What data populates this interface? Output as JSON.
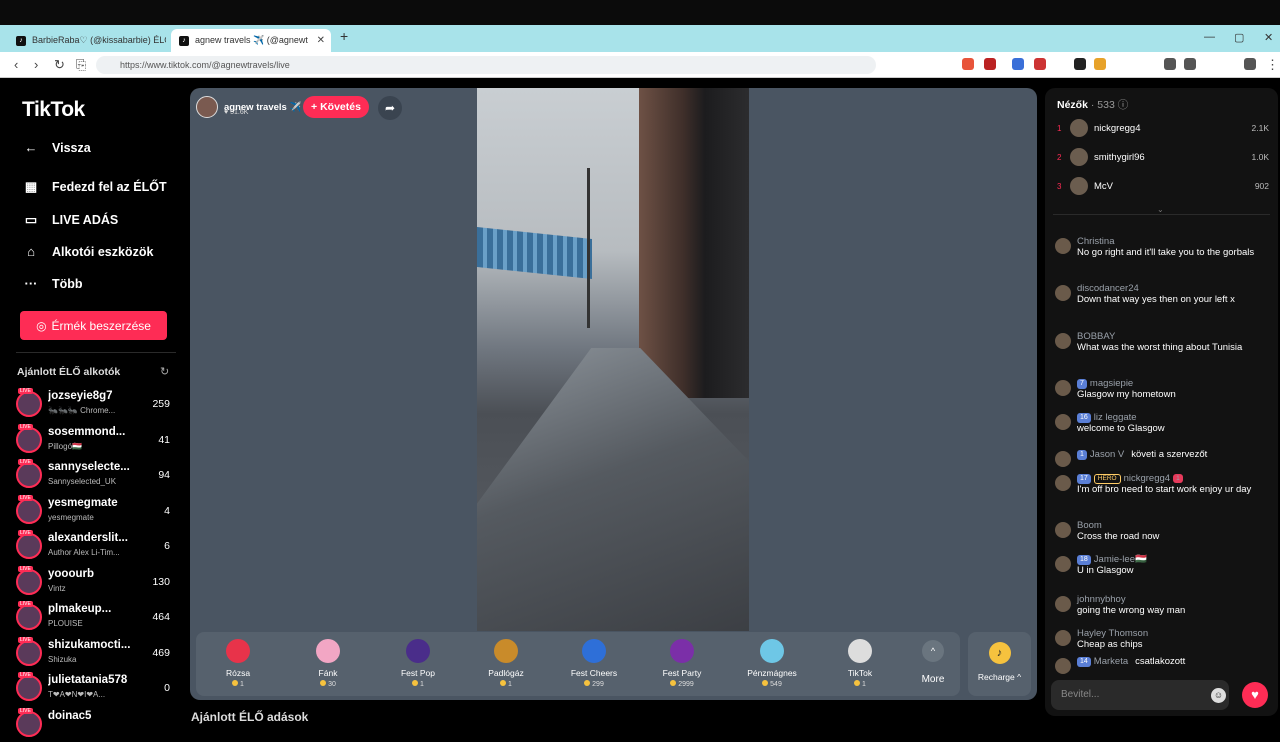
{
  "browser": {
    "tabs": [
      {
        "title": "BarbieRaba♡ (@kissabarbie) ÉLŐ a"
      },
      {
        "title": "agnew travels ✈️ (@agnewt"
      }
    ],
    "new_tab": "+",
    "url": "https://www.tiktok.com/@agnewtravels/live",
    "win_min": "—",
    "win_max": "▢",
    "win_close": "✕"
  },
  "sidebar": {
    "logo": "TikTok",
    "back": "Vissza",
    "menu": [
      {
        "label": "Fedezd fel az ÉLŐT",
        "icon": "calendar-icon"
      },
      {
        "label": "LIVE ADÁS",
        "icon": "camera-icon"
      },
      {
        "label": "Alkotói eszközök",
        "icon": "creator-tools-icon"
      },
      {
        "label": "Több",
        "icon": "more-icon"
      }
    ],
    "coins_button": "Érmék beszerzése",
    "recommended_title": "Ajánlott ÉLŐ alkotók",
    "recommended": [
      {
        "name": "jozseyie8g7",
        "sub": "🐜🐜🐜 Chrome...",
        "count": "259"
      },
      {
        "name": "sosemmond...",
        "sub": "Pillogó🇭🇺",
        "count": "41"
      },
      {
        "name": "sannyselecte...",
        "sub": "Sannyselected_UK",
        "count": "94"
      },
      {
        "name": "yesmegmate",
        "sub": "yesmegmate",
        "count": "4"
      },
      {
        "name": "alexanderslit...",
        "sub": "Author Alex Li-Tim...",
        "count": "6"
      },
      {
        "name": "yooourb",
        "sub": "Vintz",
        "count": "130"
      },
      {
        "name": "plmakeup...",
        "sub": "PLOUISE",
        "count": "464"
      },
      {
        "name": "shizukamocti...",
        "sub": "Shizuka",
        "count": "469"
      },
      {
        "name": "julietatania578",
        "sub": "T❤A❤N❤I❤A...",
        "count": "0"
      },
      {
        "name": "doinac5",
        "sub": "",
        "count": ""
      }
    ]
  },
  "stream": {
    "host_name": "agnew travels ✈️",
    "host_likes": "♥ 51.6K",
    "follow_button": "+ Követés",
    "gifts": [
      {
        "name": "Rózsa",
        "price": "1",
        "color": "#e8334a"
      },
      {
        "name": "Fánk",
        "price": "30",
        "color": "#f2a6c4"
      },
      {
        "name": "Fest Pop",
        "price": "1",
        "color": "#4a2d8a"
      },
      {
        "name": "Padlógáz",
        "price": "1",
        "color": "#c98b2a"
      },
      {
        "name": "Fest Cheers",
        "price": "299",
        "color": "#2e6fd8"
      },
      {
        "name": "Fest Party",
        "price": "2999",
        "color": "#7b2fa8"
      },
      {
        "name": "Pénzmágnes",
        "price": "549",
        "color": "#6ec7e6"
      },
      {
        "name": "TikTok",
        "price": "1",
        "color": "#ddd"
      }
    ],
    "more_label": "More",
    "recharge_label": "Recharge ^",
    "below_title": "Ajánlott ÉLŐ adások"
  },
  "chat": {
    "viewers_title": "Nézők",
    "viewers_count": "· 533",
    "top_viewers": [
      {
        "rank": "1",
        "name": "nickgregg4",
        "score": "2.1K"
      },
      {
        "rank": "2",
        "name": "smithygirl96",
        "score": "1.0K"
      },
      {
        "rank": "3",
        "name": "McV",
        "score": "902"
      }
    ],
    "messages": [
      {
        "user": "Christina",
        "text": "No go right and it'll take you to the gorbals"
      },
      {
        "user": "discodancer24",
        "text": "Down that way yes then on your left x"
      },
      {
        "user": "BOBBAY",
        "text": "What was the worst thing about Tunisia"
      },
      {
        "user": "magsiepie",
        "badge": "7",
        "text": "Glasgow my hometown"
      },
      {
        "user": "liz leggate",
        "badge": "16",
        "text": "welcome to Glasgow"
      },
      {
        "user": "Jason V",
        "badge": "1",
        "inline": "követi a szervezőt"
      },
      {
        "user": "nickgregg4",
        "badge": "17",
        "hero": "HERO",
        "pbadge": "1",
        "text": "I'm off bro need to start work enjoy ur day"
      },
      {
        "user": "Boom",
        "text": "Cross the road now"
      },
      {
        "user": "Jamie-lee🇭🇺",
        "badge": "18",
        "text": "U in Glasgow"
      },
      {
        "user": "johnnybhoy",
        "text": "going the wrong way man"
      },
      {
        "user": "Hayley Thomson",
        "text": "Cheap as chips"
      },
      {
        "user": "Marketa",
        "badge": "14",
        "inline": "csatlakozott"
      }
    ],
    "input_placeholder": "Bevitel..."
  }
}
